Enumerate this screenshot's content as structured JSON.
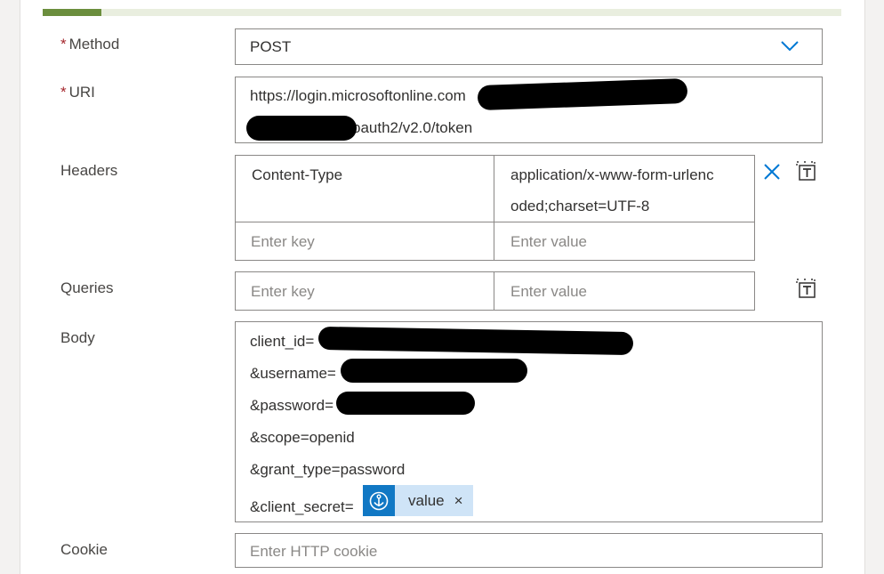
{
  "form": {
    "method": {
      "label": "Method",
      "required_mark": "*",
      "value": "POST"
    },
    "uri": {
      "label": "URI",
      "required_mark": "*",
      "line1": "https://login.microsoftonline.com",
      "line2": "oauth2/v2.0/token"
    },
    "headers": {
      "label": "Headers",
      "rows": [
        {
          "key": "Content-Type",
          "value_line1": "application/x-www-form-urlenc",
          "value_line2": "oded;charset=UTF-8"
        }
      ],
      "key_placeholder": "Enter key",
      "value_placeholder": "Enter value"
    },
    "queries": {
      "label": "Queries",
      "key_placeholder": "Enter key",
      "value_placeholder": "Enter value"
    },
    "body": {
      "label": "Body",
      "lines": [
        "client_id=",
        "&username=",
        "&password=",
        "&scope=openid",
        "&grant_type=password",
        "&client_secret="
      ],
      "token": {
        "label": "value",
        "remove": "×",
        "icon": "anchor-icon"
      }
    },
    "cookie": {
      "label": "Cookie",
      "placeholder": "Enter HTTP cookie"
    }
  },
  "colors": {
    "accent": "#6b8e3d",
    "link": "#0078d4",
    "token_bg": "#cfe4f7",
    "token_icon_bg": "#1178c4",
    "required": "#a4262c"
  }
}
